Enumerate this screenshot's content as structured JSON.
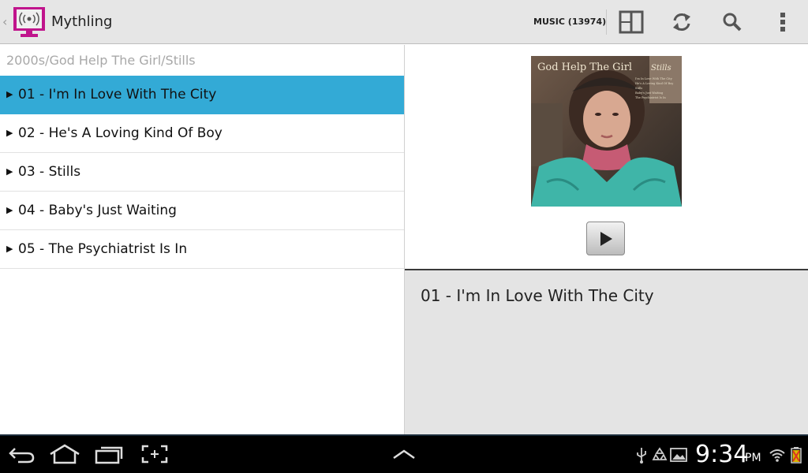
{
  "app": {
    "title": "Mythling",
    "up_caret": "‹",
    "music_count": "MUSIC (13974)",
    "actions": [
      {
        "name": "split-view-icon"
      },
      {
        "name": "refresh-icon"
      },
      {
        "name": "search-icon"
      },
      {
        "name": "overflow-menu-icon"
      }
    ]
  },
  "left": {
    "breadcrumb": "2000s/God Help The Girl/Stills",
    "tracks": [
      {
        "label": "01 - I'm In Love With The City",
        "selected": true
      },
      {
        "label": "02 - He's A Loving Kind Of Boy",
        "selected": false
      },
      {
        "label": "03 - Stills",
        "selected": false
      },
      {
        "label": "04 - Baby's Just Waiting",
        "selected": false
      },
      {
        "label": "05 - The Psychiatrist Is In",
        "selected": false
      }
    ],
    "play_arrow": "▶"
  },
  "right": {
    "album": {
      "cover_title": "God Help The Girl",
      "cover_album": "Stills",
      "cover_tracks": [
        "I'm In Love With The City",
        "He's A Loving Kind Of Boy",
        "Stills",
        "Baby's Just Waiting",
        "The Psychiatrist Is In"
      ]
    },
    "now_playing": "01 - I'm In Love With The City"
  },
  "statusbar": {
    "time": "9:34",
    "ampm": "PM"
  },
  "colors": {
    "selection": "#33aad6",
    "app_icon": "#c0148c"
  }
}
